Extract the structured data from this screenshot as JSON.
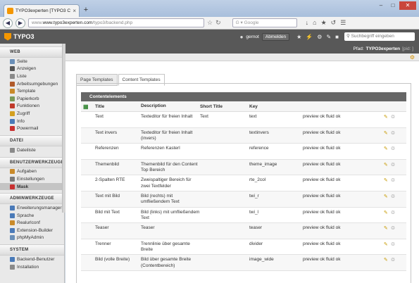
{
  "browser": {
    "tab_title": "TYPO3experten [TYPO3 CMS 6...",
    "url_host": "www.typo3experten.com",
    "url_path": "/typo3/backend.php",
    "url_prefix": "www.",
    "search_placeholder": "Google",
    "tab_close": "×",
    "new_tab": "+"
  },
  "topbar": {
    "logo": "TYPO3",
    "username": "gernot",
    "logout_label": "Abmelden",
    "search_placeholder": "Suchbegriff eingeben"
  },
  "sidebar": {
    "sections": [
      {
        "title": "WEB",
        "items": [
          {
            "label": "Seite",
            "icon": "page-icon",
            "color": "#6a8fb8"
          },
          {
            "label": "Anzeigen",
            "icon": "eye-icon",
            "color": "#555555"
          },
          {
            "label": "Liste",
            "icon": "list-icon",
            "color": "#8a8a8a"
          },
          {
            "label": "Arbeitsumgebungen",
            "icon": "workspace-icon",
            "color": "#b05a2a"
          },
          {
            "label": "Template",
            "icon": "template-icon",
            "color": "#c98a2a"
          },
          {
            "label": "Papierkorb",
            "icon": "recycler-icon",
            "color": "#7a9a5a"
          },
          {
            "label": "Funktionen",
            "icon": "functions-icon",
            "color": "#c03a2a"
          },
          {
            "label": "Zugriff",
            "icon": "access-icon",
            "color": "#d4a020"
          },
          {
            "label": "Info",
            "icon": "info-icon",
            "color": "#4a7ab8"
          },
          {
            "label": "Powermail",
            "icon": "powermail-icon",
            "color": "#c83030"
          }
        ]
      },
      {
        "title": "DATEI",
        "items": [
          {
            "label": "Dateiliste",
            "icon": "filelist-icon",
            "color": "#8a8a8a"
          }
        ]
      },
      {
        "title": "BENUTZERWERKZEUGE",
        "items": [
          {
            "label": "Aufgaben",
            "icon": "tasks-icon",
            "color": "#c98a2a"
          },
          {
            "label": "Einstellungen",
            "icon": "settings-icon",
            "color": "#7a7a7a"
          },
          {
            "label": "Mask",
            "icon": "mask-icon",
            "color": "#c83030",
            "active": true
          }
        ]
      },
      {
        "title": "ADMINWERKZEUGE",
        "items": [
          {
            "label": "Erweiterungsmanager",
            "icon": "extension-icon",
            "color": "#4a7ab8"
          },
          {
            "label": "Sprache",
            "icon": "language-icon",
            "color": "#4a7ab8"
          },
          {
            "label": "Realurlconf",
            "icon": "realurl-icon",
            "color": "#c98a2a"
          },
          {
            "label": "Extension-Builder",
            "icon": "builder-icon",
            "color": "#4a7ab8"
          },
          {
            "label": "phpMyAdmin",
            "icon": "database-icon",
            "color": "#6a8fb8"
          }
        ]
      },
      {
        "title": "SYSTEM",
        "items": [
          {
            "label": "Backend-Benutzer",
            "icon": "user-icon",
            "color": "#4a7ab8"
          },
          {
            "label": "Installation",
            "icon": "install-icon",
            "color": "#8a8a8a"
          }
        ]
      }
    ]
  },
  "docheader": {
    "path_label": "Pfad:",
    "path_value": "TYPO3experten",
    "pid": "[pid: ]"
  },
  "tabs": [
    {
      "label": "Page Templates",
      "active": false
    },
    {
      "label": "Content Templates",
      "active": true
    }
  ],
  "table": {
    "heading": "Contentelements",
    "columns": [
      "Title",
      "Description",
      "Short Title",
      "Key"
    ],
    "rows": [
      {
        "title": "Text",
        "description": "Texteditor für freien Inhalt",
        "short": "Text",
        "key": "text",
        "status": "preview ok fluid ok"
      },
      {
        "title": "Text invers",
        "description": "Texteditor für freien Inhalt (invers)",
        "short": "",
        "key": "textinvers",
        "status": "preview ok fluid ok"
      },
      {
        "title": "Referenzen",
        "description": "Referenzen Kasterl",
        "short": "",
        "key": "reference",
        "status": "preview ok fluid ok"
      },
      {
        "title": "Themenbild",
        "description": "Themenbild für den Content Top Bereich",
        "short": "",
        "key": "theme_image",
        "status": "preview ok fluid ok"
      },
      {
        "title": "2-Spalten RTE",
        "description": "Zweispaltiger Bereich für zwei Textfelder",
        "short": "",
        "key": "rte_2col",
        "status": "preview ok fluid ok"
      },
      {
        "title": "Text mit Bild",
        "description": "Bild (rechts) mit umfließendem Text",
        "short": "",
        "key": "twi_r",
        "status": "preview ok fluid ok"
      },
      {
        "title": "Bild mit Text",
        "description": "Bild (links) mit umfließendem Text",
        "short": "",
        "key": "twi_l",
        "status": "preview ok fluid ok"
      },
      {
        "title": "Teaser",
        "description": "Teaser",
        "short": "",
        "key": "teaser",
        "status": "preview ok fluid ok"
      },
      {
        "title": "Trenner",
        "description": "Trennlinie über gesamte Breite",
        "short": "",
        "key": "divider",
        "status": "preview ok fluid ok"
      },
      {
        "title": "Bild (volle Breite)",
        "description": "Bild über gesamte Breite (Contentbereich)",
        "short": "",
        "key": "image_wide",
        "status": "preview ok fluid ok"
      }
    ]
  }
}
